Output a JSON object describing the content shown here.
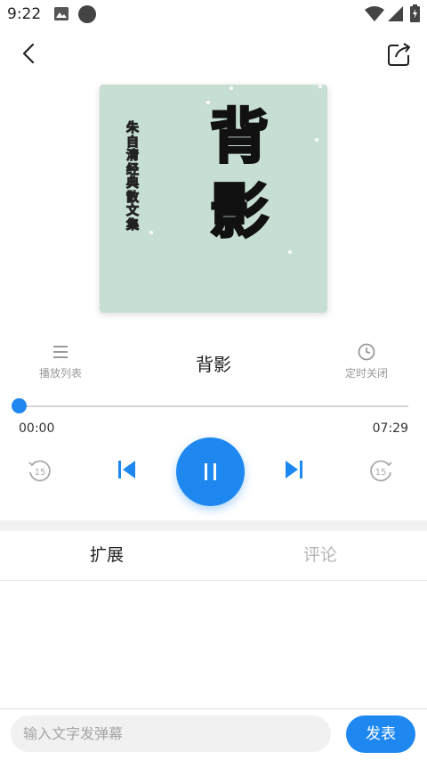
{
  "status_bar": {
    "time": "9:22"
  },
  "icons": {
    "back": "chevron-left-icon",
    "share": "share-icon",
    "playlist": "list-icon",
    "timer": "clock-icon",
    "rewind": "rewind-15-icon",
    "previous": "skip-previous-icon",
    "pause": "pause-icon",
    "next": "skip-next-icon",
    "forward": "forward-15-icon"
  },
  "cover": {
    "big_char_1": "背",
    "big_char_2": "影",
    "vertical_text": "朱自清经典散文集",
    "background": "#c7dfd3"
  },
  "player": {
    "playlist_label": "播放列表",
    "timer_label": "定时关闭",
    "title": "背影",
    "current_time": "00:00",
    "total_time": "07:29",
    "progress": 0.0
  },
  "tabs": {
    "extension": "扩展",
    "comments": "评论",
    "active": "extension"
  },
  "danmaku": {
    "placeholder": "输入文字发弹幕",
    "send_label": "发表"
  },
  "colors": {
    "accent": "#1e88f0",
    "inactive_text": "#b5b5b5"
  }
}
